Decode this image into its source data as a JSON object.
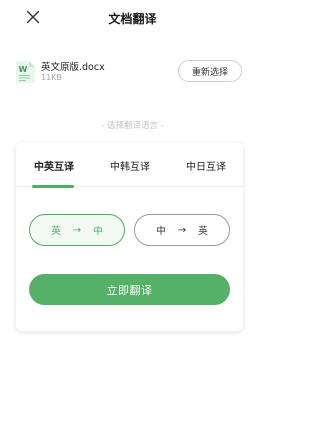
{
  "header": {
    "title": "文档翻译",
    "close_icon": "close-icon"
  },
  "file": {
    "name": "英文原版.docx",
    "size": "11KB",
    "icon": "word-document-icon",
    "reselect_label": "重新选择"
  },
  "section": {
    "label": "- 选择翻译语言 -"
  },
  "tabs": [
    {
      "label": "中英互译",
      "active": true
    },
    {
      "label": "中韩互译",
      "active": false
    },
    {
      "label": "中日互译",
      "active": false
    }
  ],
  "directions": [
    {
      "from": "英",
      "arrow": "→",
      "to": "中",
      "selected": true
    },
    {
      "from": "中",
      "arrow": "→",
      "to": "英",
      "selected": false
    }
  ],
  "action": {
    "translate_label": "立即翻译"
  },
  "colors": {
    "accent": "#4caf63",
    "button": "#55b068"
  }
}
